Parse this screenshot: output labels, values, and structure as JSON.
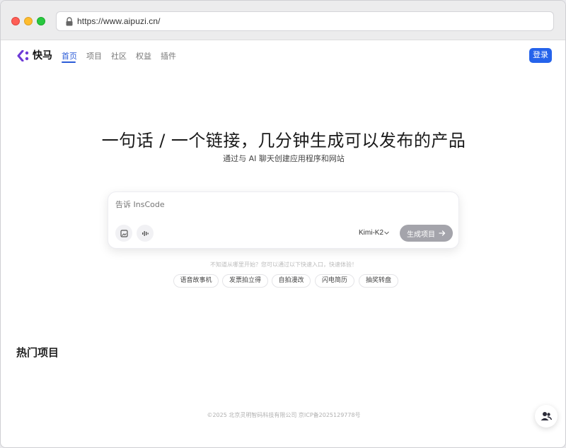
{
  "browser": {
    "url": "https://www.aipuzi.cn/"
  },
  "nav": {
    "brand": "快马",
    "items": [
      "首页",
      "项目",
      "社区",
      "权益",
      "插件"
    ],
    "login_label": "登录"
  },
  "hero": {
    "headline": "一句话 / 一个链接，几分钟生成可以发布的产品",
    "subline": "通过与 AI 聊天创建应用程序和网站"
  },
  "prompt": {
    "placeholder": "告诉 InsCode",
    "model": "Kimi-K2",
    "generate_label": "生成项目"
  },
  "hint": "不知道从哪里开始？您可以通过以下快速入口，快速体验！",
  "chips": [
    "语音故事机",
    "发票拍立得",
    "自拍漫改",
    "闪电简历",
    "抽奖转盘"
  ],
  "section_title": "热门项目",
  "footer": "©2025 北京灵明智码科技有限公司  京ICP备2025129778号",
  "icons": {
    "lock": "lock-icon",
    "logo": "brand-logo-icon",
    "image_upload": "image-icon",
    "voice": "voice-wave-icon",
    "chevron": "chevron-down-icon",
    "arrow": "arrow-right-icon",
    "support": "support-icon"
  },
  "colors": {
    "accent": "#2563eb",
    "logo_purple": "#6d3ad6",
    "disabled_button": "#a4a4ab"
  }
}
